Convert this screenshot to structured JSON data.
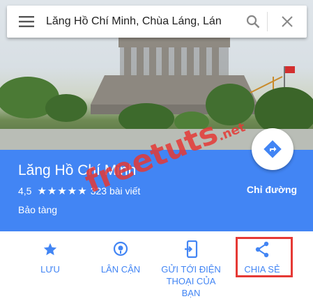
{
  "search": {
    "query": "Lăng Hồ Chí Minh, Chùa Láng, Lán"
  },
  "place": {
    "name": "Lăng Hồ Chí Minh",
    "rating": "4,5",
    "stars": "★★★★★",
    "reviews": "323 bài viết",
    "category": "Bảo tàng",
    "directions_label": "Chỉ đường"
  },
  "actions": [
    {
      "label": "LƯU",
      "icon": "star-icon"
    },
    {
      "label": "LÂN CẬN",
      "icon": "location-pin-icon"
    },
    {
      "label": "GỬI TỚI ĐIỆN THOẠI CỦA BẠN",
      "icon": "send-to-phone-icon"
    },
    {
      "label": "CHIA SẺ",
      "icon": "share-icon"
    }
  ],
  "watermark": {
    "text": "freetuts",
    "suffix": ".net"
  },
  "colors": {
    "accent": "#4285f4",
    "highlight": "#e53935"
  }
}
